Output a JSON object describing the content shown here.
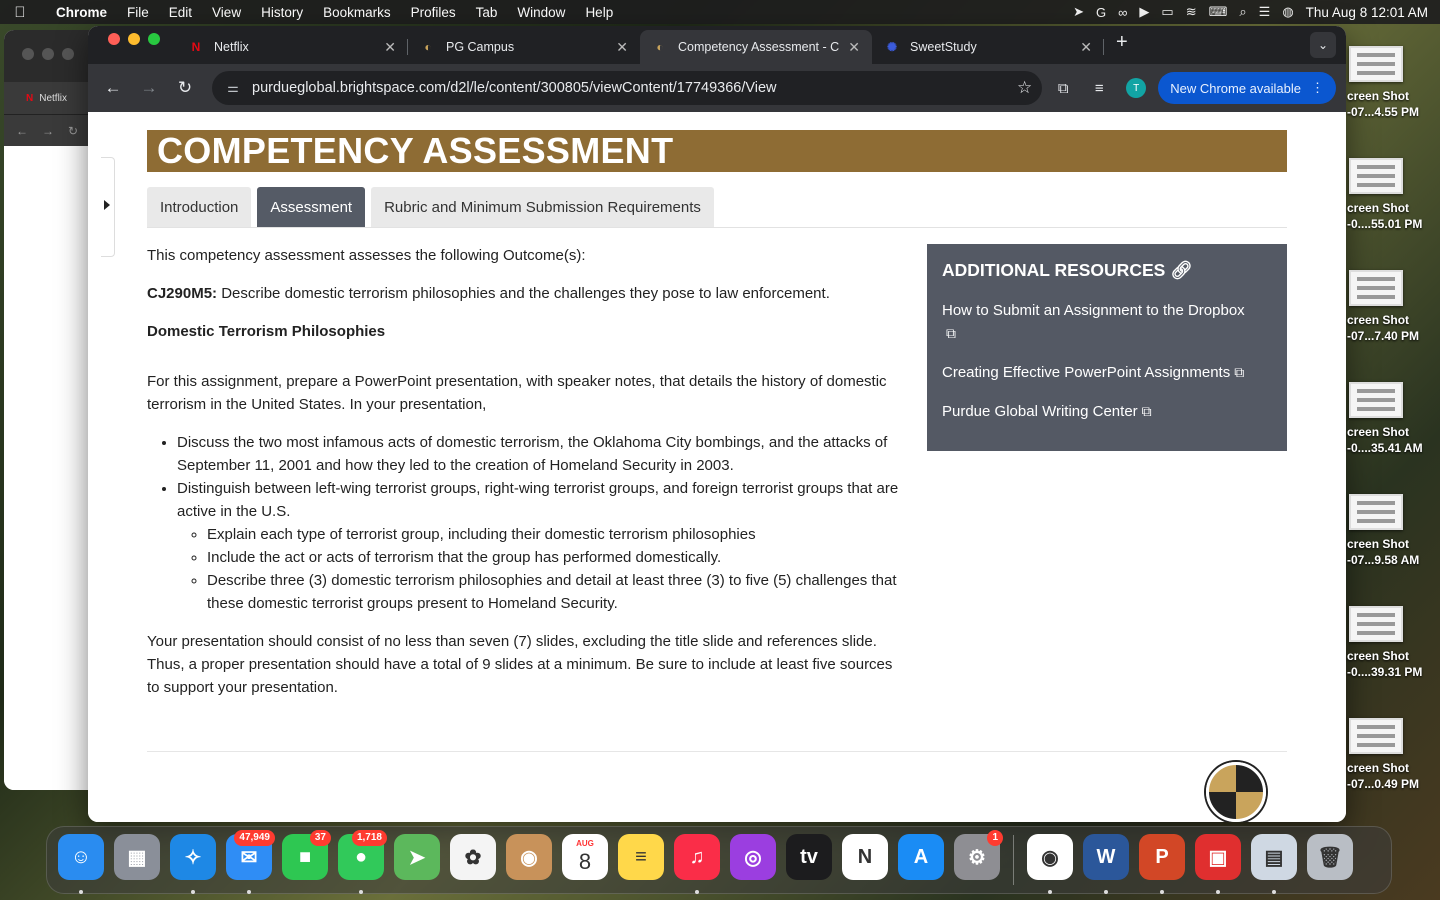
{
  "menubar": {
    "app": "Chrome",
    "items": [
      "File",
      "Edit",
      "View",
      "History",
      "Bookmarks",
      "Profiles",
      "Tab",
      "Window",
      "Help"
    ],
    "clock": "Thu Aug 8  12:01 AM"
  },
  "bg_window": {
    "tab_label": "Netflix"
  },
  "chrome": {
    "tabs": [
      {
        "title": "Netflix",
        "favicon": "netflix-icon",
        "active": false
      },
      {
        "title": "PG Campus",
        "favicon": "purdue-global-icon",
        "active": false
      },
      {
        "title": "Competency Assessment - C",
        "favicon": "purdue-global-icon",
        "active": true
      },
      {
        "title": "SweetStudy",
        "favicon": "sweetstudy-icon",
        "active": false
      }
    ],
    "url": "purdueglobal.brightspace.com/d2l/le/content/300805/viewContent/17749366/View",
    "avatar_letter": "T",
    "update_label": "New Chrome available"
  },
  "page": {
    "banner": "COMPETENCY ASSESSMENT",
    "tabs": [
      "Introduction",
      "Assessment",
      "Rubric and Minimum Submission Requirements"
    ],
    "active_tab": "Assessment",
    "intro": "This competency assessment assesses the following Outcome(s):",
    "outcome_code": "CJ290M5:",
    "outcome_text": " Describe domestic terrorism philosophies and the challenges they pose to law enforcement.",
    "section_heading": "Domestic Terrorism Philosophies",
    "assignment": "For this assignment, prepare a PowerPoint presentation, with speaker notes, that details the history of domestic terrorism in the United States. In your presentation,",
    "bullets": [
      "Discuss the two most infamous acts of domestic terrorism, the Oklahoma City bombings, and the attacks of September 11, 2001 and how they led to the creation of Homeland Security in 2003.",
      "Distinguish between left-wing terrorist groups, right-wing terrorist groups, and foreign terrorist groups that are active in the U.S."
    ],
    "sub_bullets": [
      "Explain each type of terrorist group, including their domestic terrorism philosophies",
      "Include the act or acts of terrorism that the group has performed domestically.",
      "Describe three (3) domestic terrorism philosophies and detail at least three (3) to five (5) challenges that these domestic terrorist groups present to Homeland Security."
    ],
    "closing": "Your presentation should consist of no less than seven (7) slides, excluding the title slide and references slide. Thus, a proper presentation should have a total of 9 slides at a minimum. Be sure to include at least five sources to support your presentation.",
    "resources": {
      "title": "ADDITIONAL RESOURCES",
      "links": [
        "How to Submit an Assignment to the Dropbox",
        "Creating Effective PowerPoint Assignments",
        "Purdue Global Writing Center"
      ]
    }
  },
  "desktop_files": [
    [
      "creen Shot",
      "-07...4.55 PM"
    ],
    [
      "creen Shot",
      "-0....55.01 PM"
    ],
    [
      "creen Shot",
      "-07...7.40 PM"
    ],
    [
      "creen Shot",
      "-0....35.41 AM"
    ],
    [
      "creen Shot",
      "-07...9.58 AM"
    ],
    [
      "creen Shot",
      "-0....39.31 PM"
    ],
    [
      "creen Shot",
      "-07...0.49 PM"
    ]
  ],
  "dock": {
    "apps": [
      {
        "name": "finder-icon",
        "color": "#2a8cf0",
        "glyph": "☺",
        "badge": ""
      },
      {
        "name": "launchpad-icon",
        "color": "#8a8f99",
        "glyph": "▦",
        "badge": ""
      },
      {
        "name": "safari-icon",
        "color": "#1e88e5",
        "glyph": "✧",
        "badge": ""
      },
      {
        "name": "mail-icon",
        "color": "#2f8df5",
        "glyph": "✉",
        "badge": "47,949"
      },
      {
        "name": "facetime-icon",
        "color": "#2ec752",
        "glyph": "■",
        "badge": "37"
      },
      {
        "name": "messages-icon",
        "color": "#31c95a",
        "glyph": "●",
        "badge": "1,718"
      },
      {
        "name": "maps-icon",
        "color": "#5cb85c",
        "glyph": "➤",
        "badge": ""
      },
      {
        "name": "photos-icon",
        "color": "#f4f4f4",
        "glyph": "✿",
        "badge": ""
      },
      {
        "name": "contacts-icon",
        "color": "#c8925a",
        "glyph": "◉",
        "badge": ""
      },
      {
        "name": "calendar-icon",
        "color": "#ffffff",
        "glyph": "8",
        "badge": ""
      },
      {
        "name": "notes-icon",
        "color": "#ffd84a",
        "glyph": "≡",
        "badge": ""
      },
      {
        "name": "music-icon",
        "color": "#fa2d48",
        "glyph": "♫",
        "badge": ""
      },
      {
        "name": "podcasts-icon",
        "color": "#9b3ee0",
        "glyph": "◎",
        "badge": ""
      },
      {
        "name": "tv-icon",
        "color": "#1c1c1e",
        "glyph": "tv",
        "badge": ""
      },
      {
        "name": "news-icon",
        "color": "#ffffff",
        "glyph": "N",
        "badge": ""
      },
      {
        "name": "app-store-icon",
        "color": "#1a8cf5",
        "glyph": "A",
        "badge": ""
      },
      {
        "name": "system-settings-icon",
        "color": "#8e8e93",
        "glyph": "⚙",
        "badge": "1"
      }
    ],
    "apps_right": [
      {
        "name": "chrome-icon",
        "color": "#ffffff",
        "glyph": "◉",
        "badge": ""
      },
      {
        "name": "word-icon",
        "color": "#2b579a",
        "glyph": "W",
        "badge": ""
      },
      {
        "name": "powerpoint-icon",
        "color": "#d24726",
        "glyph": "P",
        "badge": ""
      },
      {
        "name": "photo-booth-icon",
        "color": "#e02f2f",
        "glyph": "▣",
        "badge": ""
      },
      {
        "name": "preview-icon",
        "color": "#cfd8e3",
        "glyph": "▤",
        "badge": ""
      },
      {
        "name": "trash-icon",
        "color": "#b9bec5",
        "glyph": "🗑",
        "badge": ""
      }
    ],
    "calendar_month": "AUG"
  }
}
